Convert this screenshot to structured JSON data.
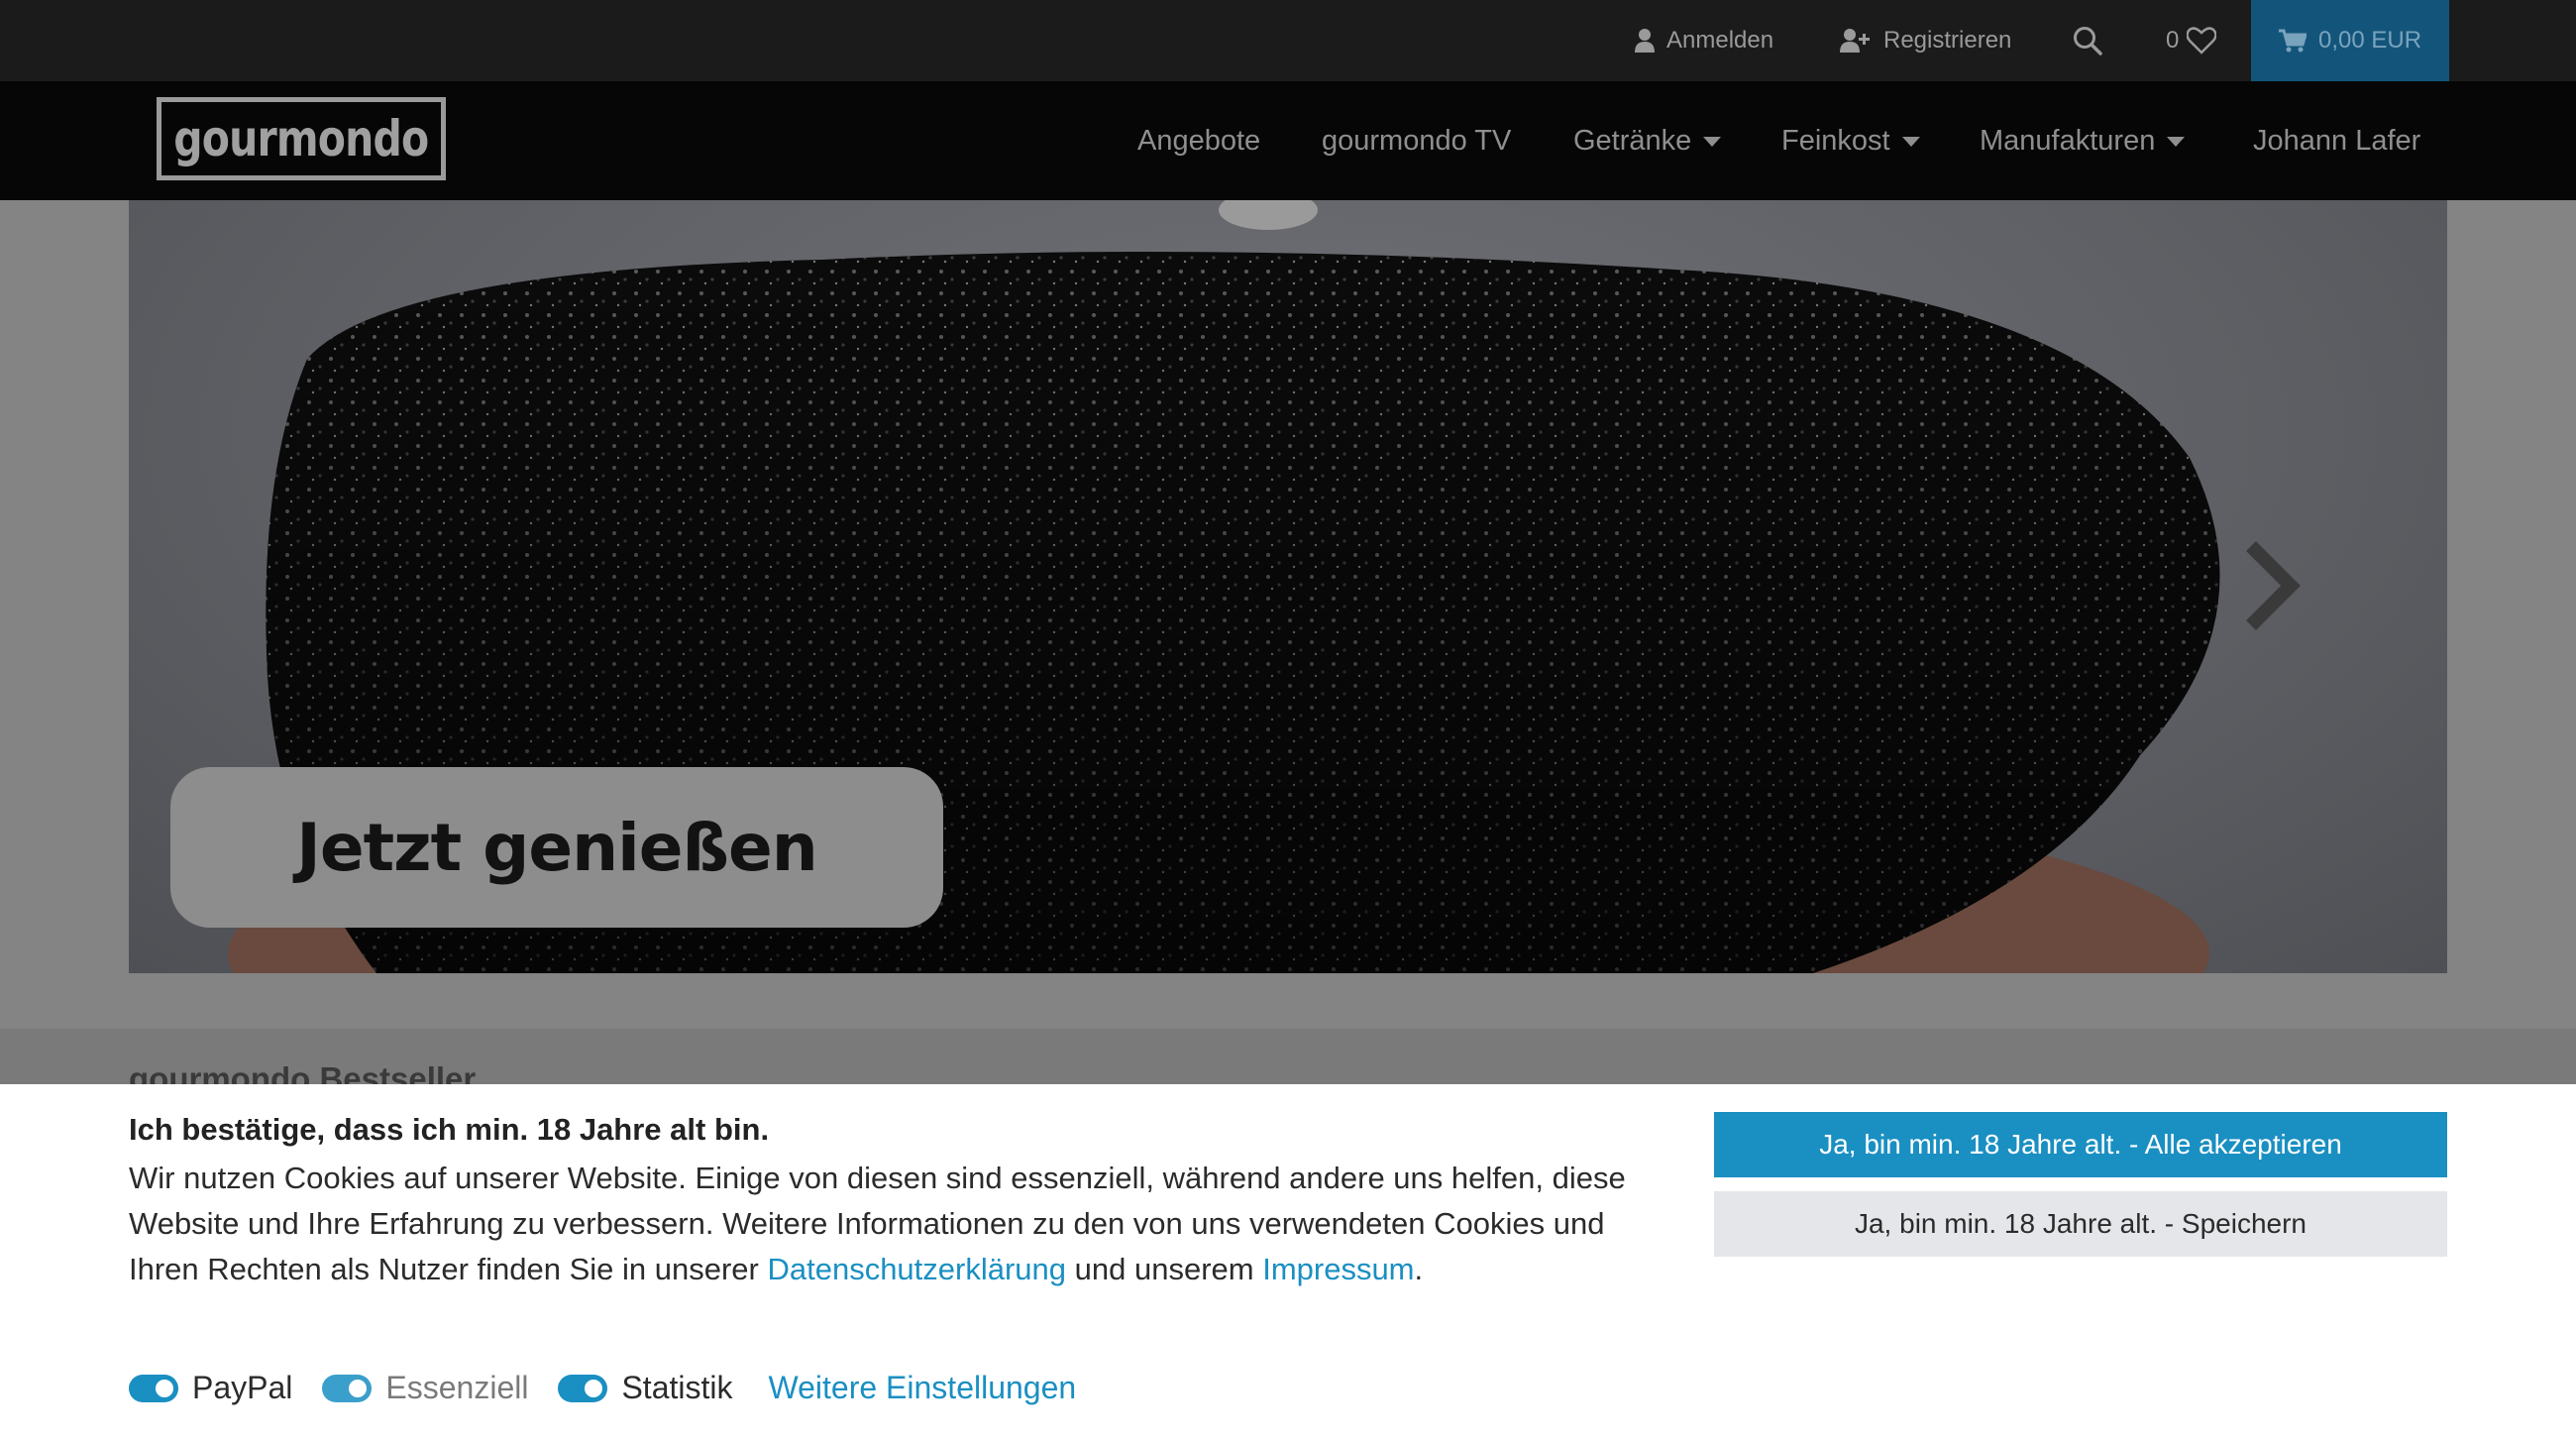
{
  "topbar": {
    "login": "Anmelden",
    "register": "Registrieren",
    "wishlist_count": "0",
    "cart_total": "0,00 EUR"
  },
  "nav": {
    "logo_text": "gourmondo",
    "items": [
      {
        "label": "Angebote"
      },
      {
        "label": "gourmondo TV"
      },
      {
        "label": "Getränke"
      },
      {
        "label": "Feinkost"
      },
      {
        "label": "Manufakturen"
      },
      {
        "label": "Johann Lafer"
      }
    ]
  },
  "hero": {
    "cta": "Jetzt genießen"
  },
  "section": {
    "title": "gourmondo Bestseller"
  },
  "cookie": {
    "title": "Ich bestätige, dass ich min. 18 Jahre alt bin.",
    "text_1": "Wir nutzen Cookies auf unserer Website. Einige von diesen sind essenziell, während andere uns helfen, diese Website und Ihre Erfahrung zu verbessern. Weitere Informationen zu den von uns verwendeten Cookies und Ihren Rechten als Nutzer finden Sie in unserer ",
    "privacy_link": "Datenschutzerklärung",
    "text_2": " und unserem ",
    "imprint_link": "Impressum",
    "text_3": ".",
    "accept_all": "Ja, bin min. 18 Jahre alt. - Alle akzeptieren",
    "save": "Ja, bin min. 18 Jahre alt. - Speichern",
    "toggles": {
      "paypal": "PayPal",
      "essential": "Essenziell",
      "statistics": "Statistik"
    },
    "more_settings": "Weitere Einstellungen"
  },
  "colors": {
    "accent": "#1a8fc2",
    "topbar_bg": "#1b1b1b",
    "nav_bg": "#060606"
  }
}
